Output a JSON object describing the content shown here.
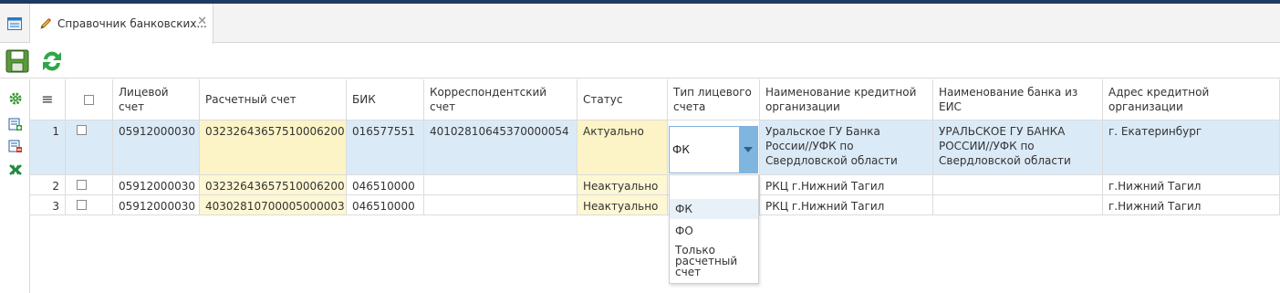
{
  "tab": {
    "title": "Справочник банковских..."
  },
  "icons": {
    "apps": "window-list-icon",
    "edit": "pencil-icon",
    "close": "close-icon",
    "save": "floppy-save-icon",
    "refresh": "refresh-arrows-icon",
    "settings": "gear-icon",
    "add": "add-row-icon",
    "remove": "remove-row-icon",
    "excel": "excel-icon"
  },
  "colors": {
    "accent": "#7eb6df",
    "row_selected": "#dbeaf7",
    "highlight_cell": "#fdf7d3",
    "refresh": "#2ea84a"
  },
  "columns": {
    "menu": "≡",
    "account": "Лицевой счет",
    "settlement": "Расчетный счет",
    "bik": "БИК",
    "corr": "Корреспондентский счет",
    "status": "Статус",
    "type": "Тип лицевого счета",
    "name": "Наименование кредитной организации",
    "eis": "Наименование банка из ЕИС",
    "address": "Адрес кредитной организации"
  },
  "rows": [
    {
      "num": "1",
      "account": "05912000030",
      "settlement": "03232643657510006200",
      "bik": "016577551",
      "corr": "40102810645370000054",
      "status": "Актуально",
      "type": "ФК",
      "name": "Уральское ГУ Банка России//УФК по Свердловской области",
      "eis": "УРАЛЬСКОЕ ГУ БАНКА РОССИИ//УФК по Свердловской области",
      "address": "г. Екатеринбург"
    },
    {
      "num": "2",
      "account": "05912000030",
      "settlement": "03232643657510006200",
      "bik": "046510000",
      "corr": "",
      "status": "Неактуально",
      "type": "",
      "name": "РКЦ г.Нижний Тагил",
      "eis": "",
      "address": "г.Нижний Тагил"
    },
    {
      "num": "3",
      "account": "05912000030",
      "settlement": "40302810700005000003",
      "bik": "046510000",
      "corr": "",
      "status": "Неактуально",
      "type": "",
      "name": "РКЦ г.Нижний Тагил",
      "eis": "",
      "address": "г.Нижний Тагил"
    }
  ],
  "type_select": {
    "value": "ФК",
    "options": [
      "",
      "ФК",
      "ФО",
      "Только расчетный счет"
    ]
  }
}
